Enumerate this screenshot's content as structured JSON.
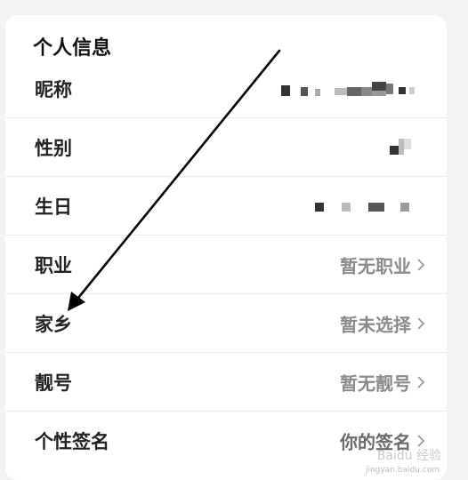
{
  "section": {
    "title": "个人信息"
  },
  "rows": [
    {
      "label": "昵称",
      "value": "",
      "redacted": true
    },
    {
      "label": "性别",
      "value": "",
      "redacted": true
    },
    {
      "label": "生日",
      "value": "",
      "redacted": true
    },
    {
      "label": "职业",
      "value": "暂无职业"
    },
    {
      "label": "家乡",
      "value": "暂未选择"
    },
    {
      "label": "靓号",
      "value": "暂无靓号"
    },
    {
      "label": "个性签名",
      "value": "你的签名"
    }
  ],
  "annotation": {
    "type": "arrow",
    "points_to": "家乡",
    "color": "#000000"
  },
  "watermark": {
    "text": "Baidu 经验",
    "url": "jingyan.baidu.com"
  },
  "colors": {
    "background": "#f2f2f4",
    "card": "#ffffff",
    "label": "#222222",
    "value": "#8a8a8a"
  }
}
